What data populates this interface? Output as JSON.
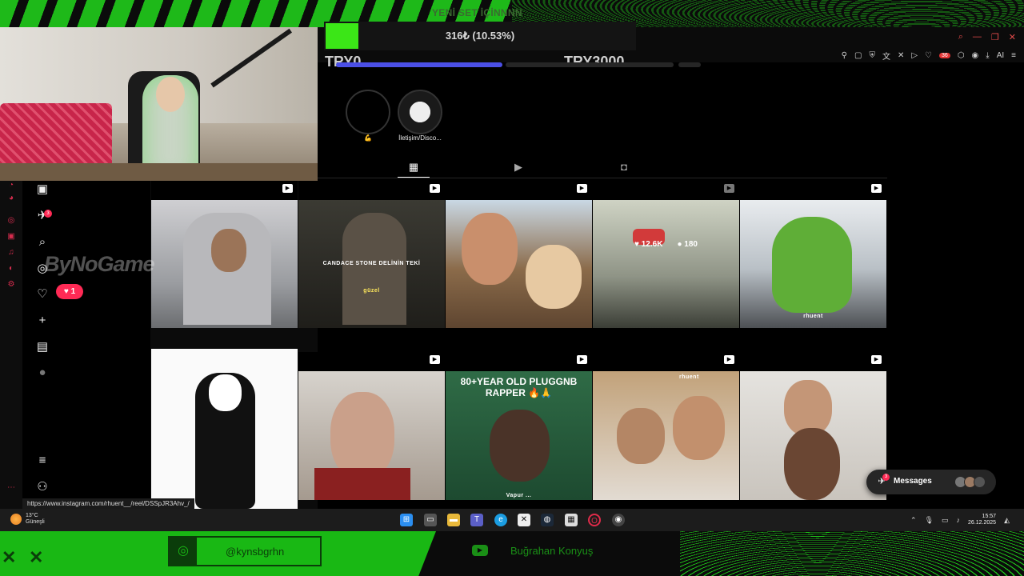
{
  "overlay": {
    "top_banner": "YENİ SET İÇİNNNN",
    "donation_text": "316₺ (10.53%)",
    "donation_progress": 0.1053,
    "goal_start": "TRY0",
    "goal_end": "TRY3000",
    "watermark": "ByNoGame",
    "instagram_handle": "@kynsbgrhn",
    "youtube_name": "Buğrahan Konyuş",
    "accent_color": "#19b814"
  },
  "browser": {
    "window_controls": [
      "search-icon",
      "minimize-icon",
      "restore-icon",
      "close-icon"
    ],
    "toolbar_badge": "36",
    "toolbar_ai": "AI",
    "status_url": "https://www.instagram.com/rhuent__/reel/DSSpJR3Ahv_/"
  },
  "instagram": {
    "sidebar": {
      "notifications_count": "3",
      "likes_count": "1"
    },
    "highlights": [
      {
        "label": "💪"
      },
      {
        "label": "İletişim/Disco..."
      }
    ],
    "tabs": [
      "grid-icon",
      "reels-icon",
      "tagged-icon"
    ],
    "posts": [
      {
        "caption": "",
        "type": "reel"
      },
      {
        "caption": "CANDACE STONE DELİNİN TEKİ",
        "subcaption": "güzel",
        "type": "reel"
      },
      {
        "caption": "",
        "type": "reel"
      },
      {
        "caption": "",
        "likes": "12.6K",
        "comments": "180",
        "type": "reel"
      },
      {
        "caption": "",
        "subcaption": "rhuent",
        "type": "reel"
      },
      {
        "caption": "",
        "type": "image"
      },
      {
        "caption": "",
        "type": "reel"
      },
      {
        "caption": "80+YEAR OLD PLUGGNB RAPPER 🔥🙏",
        "subcaption": "Vapur ...",
        "type": "reel"
      },
      {
        "caption": "",
        "subcaption": "rhuent",
        "type": "reel"
      },
      {
        "caption": "",
        "type": "reel"
      }
    ],
    "messages_label": "Messages",
    "messages_count": "3"
  },
  "taskbar": {
    "weather_temp": "13°C",
    "weather_desc": "Güneşli",
    "time": "15:57",
    "date": "26.12.2025"
  }
}
